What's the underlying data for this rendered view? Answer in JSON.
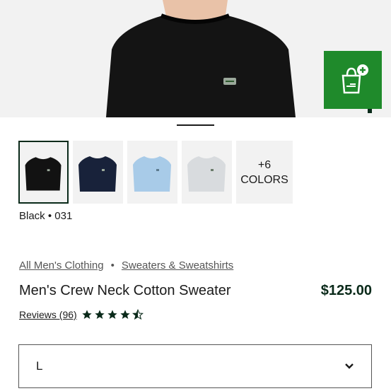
{
  "color": {
    "name": "Black",
    "code": "031",
    "separator": "•"
  },
  "thumbnails": [
    {
      "color_name": "black",
      "hex": "#121212"
    },
    {
      "color_name": "navy",
      "hex": "#18223a"
    },
    {
      "color_name": "light-blue",
      "hex": "#a8cbe8"
    },
    {
      "color_name": "light-grey",
      "hex": "#d8dbde"
    }
  ],
  "more_colors": {
    "count": "+6",
    "label": "COLORS"
  },
  "breadcrumb": {
    "items": [
      "All Men's Clothing",
      "Sweaters & Sweatshirts"
    ],
    "separator": "•"
  },
  "product": {
    "title": "Men's Crew Neck Cotton Sweater",
    "price": "$125.00"
  },
  "reviews": {
    "label": "Reviews (96)",
    "rating": 4.5
  },
  "size": {
    "selected": "L"
  },
  "icons": {
    "cart": "shopping-bag-plus-icon",
    "dropdown": "chevron-down-icon"
  },
  "colors": {
    "brand_green": "#1f8a2b",
    "dark_green": "#0a2a1a"
  }
}
